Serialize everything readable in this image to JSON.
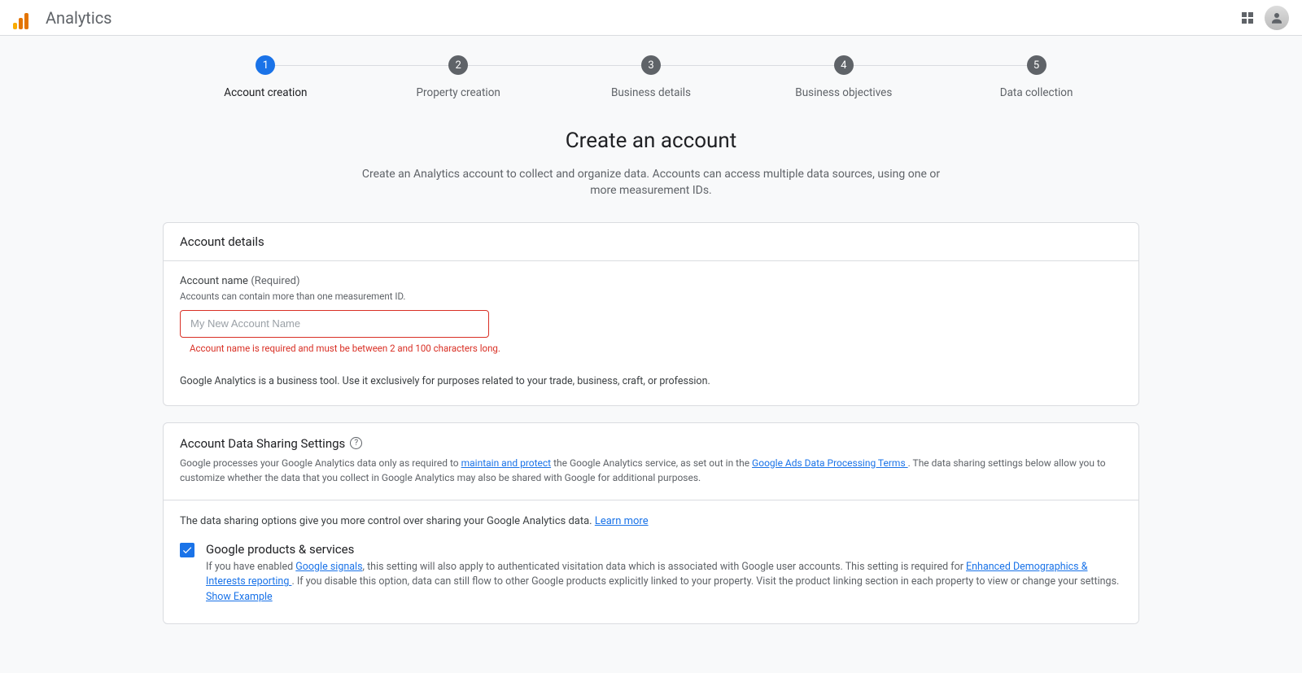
{
  "header": {
    "app_title": "Analytics"
  },
  "stepper": {
    "steps": [
      {
        "num": "1",
        "label": "Account creation",
        "active": true
      },
      {
        "num": "2",
        "label": "Property creation",
        "active": false
      },
      {
        "num": "3",
        "label": "Business details",
        "active": false
      },
      {
        "num": "4",
        "label": "Business objectives",
        "active": false
      },
      {
        "num": "5",
        "label": "Data collection",
        "active": false
      }
    ]
  },
  "page": {
    "heading": "Create an account",
    "subheading": "Create an Analytics account to collect and organize data. Accounts can access multiple data sources, using one or more measurement IDs."
  },
  "account_details": {
    "card_title": "Account details",
    "name_label": "Account name",
    "name_required": "(Required)",
    "name_help": "Accounts can contain more than one measurement ID.",
    "name_placeholder": "My New Account Name",
    "name_value": "",
    "name_error": "Account name is required and must be between 2 and 100 characters long.",
    "note": "Google Analytics is a business tool. Use it exclusively for purposes related to your trade, business, craft, or profession."
  },
  "data_sharing": {
    "title": "Account Data Sharing Settings",
    "desc_pre": "Google processes your Google Analytics data only as required to ",
    "link1": "maintain and protect",
    "desc_mid": " the Google Analytics service, as set out in the ",
    "link2": "Google Ads Data Processing Terms ",
    "desc_post": ". The data sharing settings below allow you to customize whether the data that you collect in Google Analytics may also be shared with Google for additional purposes.",
    "body_text": "The data sharing options give you more control over sharing your Google Analytics data. ",
    "learn_more": "Learn more",
    "option1": {
      "title": "Google products & services",
      "desc_pre": "If you have enabled ",
      "link_signals": "Google signals",
      "desc_mid": ", this setting will also apply to authenticated visitation data which is associated with Google user accounts. This setting is required for ",
      "link_edi": "Enhanced Demographics & Interests reporting ",
      "desc_post": ". If you disable this option, data can still flow to other Google products explicitly linked to your property. Visit the product linking section in each property to view or change your settings. ",
      "show_example": "Show Example"
    }
  }
}
